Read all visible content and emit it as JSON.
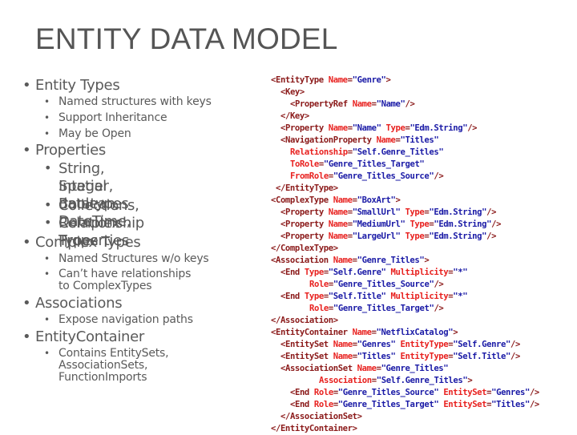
{
  "slide": {
    "title": "ENTITY DATA MODEL"
  },
  "bullets": {
    "entity_types": "Entity Types",
    "entity_types_sub": [
      "Named structures with keys",
      "Support Inheritance",
      "May be Open"
    ],
    "properties": "Properties",
    "properties_sub": [
      "String, Integer, Boolean, DateTime,",
      "Spatial datatypes",
      "Collections, Complex Types",
      "Relationship Properties"
    ],
    "complex_types": "Complex Types",
    "complex_types_sub": [
      "Named Structures w/o keys",
      "Can’t have relationships",
      "to ComplexTypes"
    ],
    "associations": "Associations",
    "associations_sub": [
      "Expose navigation paths"
    ],
    "entity_container": "EntityContainer",
    "entity_container_sub": [
      "Contains EntitySets,",
      "AssociationSets,",
      "FunctionImports"
    ]
  },
  "bullet_glyph": "•",
  "code_lines": [
    {
      "indent": 0,
      "parts": [
        [
          "t",
          "<EntityType "
        ],
        [
          "a",
          "Name"
        ],
        [
          "t",
          "="
        ],
        [
          "v",
          "\"Genre\""
        ],
        [
          "t",
          ">"
        ]
      ]
    },
    {
      "indent": 1,
      "parts": [
        [
          "t",
          "<Key>"
        ]
      ]
    },
    {
      "indent": 2,
      "parts": [
        [
          "t",
          "<PropertyRef "
        ],
        [
          "a",
          "Name"
        ],
        [
          "t",
          "="
        ],
        [
          "v",
          "\"Name\""
        ],
        [
          "t",
          "/>"
        ]
      ]
    },
    {
      "indent": 1,
      "parts": [
        [
          "t",
          "</Key>"
        ]
      ]
    },
    {
      "indent": 1,
      "parts": [
        [
          "t",
          "<Property "
        ],
        [
          "a",
          "Name"
        ],
        [
          "t",
          "="
        ],
        [
          "v",
          "\"Name\""
        ],
        [
          "t",
          " "
        ],
        [
          "a",
          "Type"
        ],
        [
          "t",
          "="
        ],
        [
          "v",
          "\"Edm.String\""
        ],
        [
          "t",
          "/>"
        ]
      ]
    },
    {
      "indent": 1,
      "parts": [
        [
          "t",
          "<NavigationProperty "
        ],
        [
          "a",
          "Name"
        ],
        [
          "t",
          "="
        ],
        [
          "v",
          "\"Titles\""
        ]
      ]
    },
    {
      "indent": 2,
      "parts": [
        [
          "a",
          "Relationship"
        ],
        [
          "t",
          "="
        ],
        [
          "v",
          "\"Self.Genre_Titles\""
        ]
      ]
    },
    {
      "indent": 2,
      "parts": [
        [
          "a",
          "ToRole"
        ],
        [
          "t",
          "="
        ],
        [
          "v",
          "\"Genre_Titles_Target\""
        ]
      ]
    },
    {
      "indent": 2,
      "parts": [
        [
          "a",
          "FromRole"
        ],
        [
          "t",
          "="
        ],
        [
          "v",
          "\"Genre_Titles_Source\""
        ],
        [
          "t",
          "/>"
        ]
      ]
    },
    {
      "indent": 0.5,
      "parts": [
        [
          "t",
          "</EntityType>"
        ]
      ]
    },
    {
      "indent": 0,
      "parts": [
        [
          "t",
          "<ComplexType "
        ],
        [
          "a",
          "Name"
        ],
        [
          "t",
          "="
        ],
        [
          "v",
          "\"BoxArt\""
        ],
        [
          "t",
          ">"
        ]
      ]
    },
    {
      "indent": 1,
      "parts": [
        [
          "t",
          "<Property "
        ],
        [
          "a",
          "Name"
        ],
        [
          "t",
          "="
        ],
        [
          "v",
          "\"SmallUrl\""
        ],
        [
          "t",
          " "
        ],
        [
          "a",
          "Type"
        ],
        [
          "t",
          "="
        ],
        [
          "v",
          "\"Edm.String\""
        ],
        [
          "t",
          "/>"
        ]
      ]
    },
    {
      "indent": 1,
      "parts": [
        [
          "t",
          "<Property "
        ],
        [
          "a",
          "Name"
        ],
        [
          "t",
          "="
        ],
        [
          "v",
          "\"MediumUrl\""
        ],
        [
          "t",
          " "
        ],
        [
          "a",
          "Type"
        ],
        [
          "t",
          "="
        ],
        [
          "v",
          "\"Edm.String\""
        ],
        [
          "t",
          "/>"
        ]
      ]
    },
    {
      "indent": 1,
      "parts": [
        [
          "t",
          "<Property "
        ],
        [
          "a",
          "Name"
        ],
        [
          "t",
          "="
        ],
        [
          "v",
          "\"LargeUrl\""
        ],
        [
          "t",
          " "
        ],
        [
          "a",
          "Type"
        ],
        [
          "t",
          "="
        ],
        [
          "v",
          "\"Edm.String\""
        ],
        [
          "t",
          "/>"
        ]
      ]
    },
    {
      "indent": 0,
      "parts": [
        [
          "t",
          "</ComplexType>"
        ]
      ]
    },
    {
      "indent": 0,
      "parts": [
        [
          "t",
          "<Association "
        ],
        [
          "a",
          "Name"
        ],
        [
          "t",
          "="
        ],
        [
          "v",
          "\"Genre_Titles\""
        ],
        [
          "t",
          ">"
        ]
      ]
    },
    {
      "indent": 1,
      "parts": [
        [
          "t",
          "<End "
        ],
        [
          "a",
          "Type"
        ],
        [
          "t",
          "="
        ],
        [
          "v",
          "\"Self.Genre\""
        ],
        [
          "t",
          " "
        ],
        [
          "a",
          "Multiplicity"
        ],
        [
          "t",
          "="
        ],
        [
          "v",
          "\"*\""
        ]
      ]
    },
    {
      "indent": 4,
      "parts": [
        [
          "a",
          "Role"
        ],
        [
          "t",
          "="
        ],
        [
          "v",
          "\"Genre_Titles_Source\""
        ],
        [
          "t",
          "/>"
        ]
      ]
    },
    {
      "indent": 1,
      "parts": [
        [
          "t",
          "<End "
        ],
        [
          "a",
          "Type"
        ],
        [
          "t",
          "="
        ],
        [
          "v",
          "\"Self.Title\""
        ],
        [
          "t",
          " "
        ],
        [
          "a",
          "Multiplicity"
        ],
        [
          "t",
          "="
        ],
        [
          "v",
          "\"*\""
        ]
      ]
    },
    {
      "indent": 4,
      "parts": [
        [
          "a",
          "Role"
        ],
        [
          "t",
          "="
        ],
        [
          "v",
          "\"Genre_Titles_Target\""
        ],
        [
          "t",
          "/>"
        ]
      ]
    },
    {
      "indent": 0,
      "parts": [
        [
          "t",
          "</Association>"
        ]
      ]
    },
    {
      "indent": 0,
      "parts": [
        [
          "t",
          "<EntityContainer "
        ],
        [
          "a",
          "Name"
        ],
        [
          "t",
          "="
        ],
        [
          "v",
          "\"NetflixCatalog\""
        ],
        [
          "t",
          ">"
        ]
      ]
    },
    {
      "indent": 1,
      "parts": [
        [
          "t",
          "<EntitySet "
        ],
        [
          "a",
          "Name"
        ],
        [
          "t",
          "="
        ],
        [
          "v",
          "\"Genres\""
        ],
        [
          "t",
          " "
        ],
        [
          "a",
          "EntityType"
        ],
        [
          "t",
          "="
        ],
        [
          "v",
          "\"Self.Genre\""
        ],
        [
          "t",
          "/>"
        ]
      ]
    },
    {
      "indent": 1,
      "parts": [
        [
          "t",
          "<EntitySet "
        ],
        [
          "a",
          "Name"
        ],
        [
          "t",
          "="
        ],
        [
          "v",
          "\"Titles\""
        ],
        [
          "t",
          " "
        ],
        [
          "a",
          "EntityType"
        ],
        [
          "t",
          "="
        ],
        [
          "v",
          "\"Self.Title\""
        ],
        [
          "t",
          "/>"
        ]
      ]
    },
    {
      "indent": 1,
      "parts": [
        [
          "t",
          "<AssociationSet "
        ],
        [
          "a",
          "Name"
        ],
        [
          "t",
          "="
        ],
        [
          "v",
          "\"Genre_Titles\""
        ]
      ]
    },
    {
      "indent": 5,
      "parts": [
        [
          "a",
          "Association"
        ],
        [
          "t",
          "="
        ],
        [
          "v",
          "\"Self.Genre_Titles\""
        ],
        [
          "t",
          ">"
        ]
      ]
    },
    {
      "indent": 2,
      "parts": [
        [
          "t",
          "<End "
        ],
        [
          "a",
          "Role"
        ],
        [
          "t",
          "="
        ],
        [
          "v",
          "\"Genre_Titles_Source\""
        ],
        [
          "t",
          " "
        ],
        [
          "a",
          "EntitySet"
        ],
        [
          "t",
          "="
        ],
        [
          "v",
          "\"Genres\""
        ],
        [
          "t",
          "/>"
        ]
      ]
    },
    {
      "indent": 2,
      "parts": [
        [
          "t",
          "<End "
        ],
        [
          "a",
          "Role"
        ],
        [
          "t",
          "="
        ],
        [
          "v",
          "\"Genre_Titles_Target\""
        ],
        [
          "t",
          " "
        ],
        [
          "a",
          "EntitySet"
        ],
        [
          "t",
          "="
        ],
        [
          "v",
          "\"Titles\""
        ],
        [
          "t",
          "/>"
        ]
      ]
    },
    {
      "indent": 1,
      "parts": [
        [
          "t",
          "</AssociationSet>"
        ]
      ]
    },
    {
      "indent": 0,
      "parts": [
        [
          "t",
          "</EntityContainer>"
        ]
      ]
    }
  ],
  "colors": {
    "tag": "#8b1a1a",
    "attribute": "#e8201e",
    "value": "#1a1aa6",
    "body_text": "#5a5a5a",
    "title": "#555555"
  }
}
